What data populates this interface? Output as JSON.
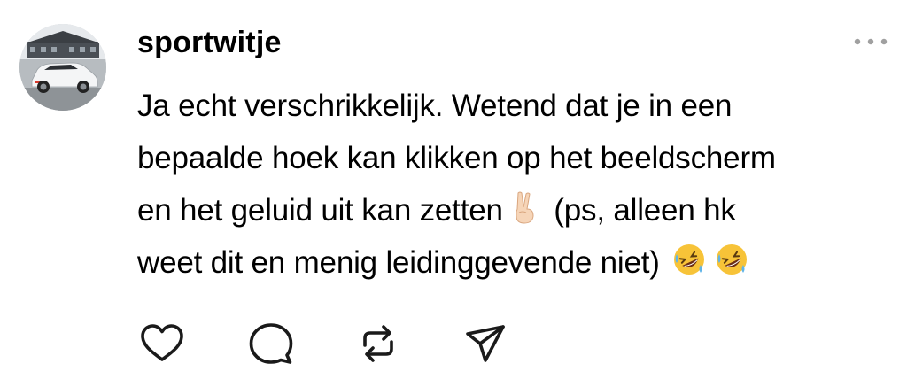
{
  "post": {
    "username": "sportwitje",
    "avatar_icon": "car-photo-avatar",
    "more_icon": "more-dots-icon",
    "text_lines": [
      "Ja echt verschrikkelijk. Wetend dat je in een",
      "bepaalde hoek kan klikken op het beeldscherm",
      "en het geluid uit kan zetten",
      "(ps, alleen hk",
      "weet dit en menig leidinggevende niet)"
    ],
    "emojis": [
      "victory-hand-emoji",
      "rolling-on-the-floor-laughing-emoji",
      "rolling-on-the-floor-laughing-emoji"
    ]
  },
  "actions": {
    "like_icon": "heart-icon",
    "reply_icon": "comment-bubble-icon",
    "repost_icon": "repost-icon",
    "share_icon": "send-icon"
  },
  "colors": {
    "text": "#000000",
    "icon": "#1a1a1a",
    "muted": "#a0a0a0",
    "background": "#ffffff"
  }
}
